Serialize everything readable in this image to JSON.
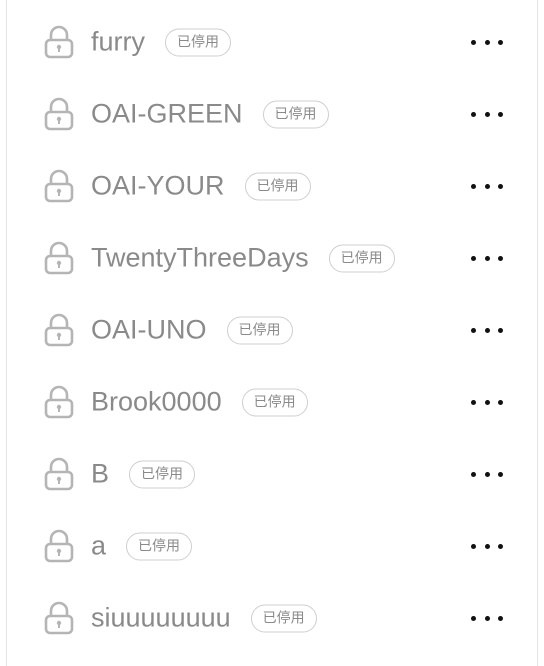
{
  "colors": {
    "name_text": "#8a8a8a",
    "badge_border": "#cfcfcf",
    "lock_icon": "#b5b5b5",
    "more_dots": "#111111"
  },
  "items": [
    {
      "name": "furry",
      "badge": "已停用",
      "icon": "lock-icon"
    },
    {
      "name": "OAI-GREEN",
      "badge": "已停用",
      "icon": "lock-icon"
    },
    {
      "name": "OAI-YOUR",
      "badge": "已停用",
      "icon": "lock-icon"
    },
    {
      "name": "TwentyThreeDays",
      "badge": "已停用",
      "icon": "lock-icon"
    },
    {
      "name": "OAI-UNO",
      "badge": "已停用",
      "icon": "lock-icon"
    },
    {
      "name": "Brook0000",
      "badge": "已停用",
      "icon": "lock-icon"
    },
    {
      "name": "B",
      "badge": "已停用",
      "icon": "lock-icon"
    },
    {
      "name": "a",
      "badge": "已停用",
      "icon": "lock-icon"
    },
    {
      "name": "siuuuuuuuu",
      "badge": "已停用",
      "icon": "lock-icon"
    }
  ]
}
